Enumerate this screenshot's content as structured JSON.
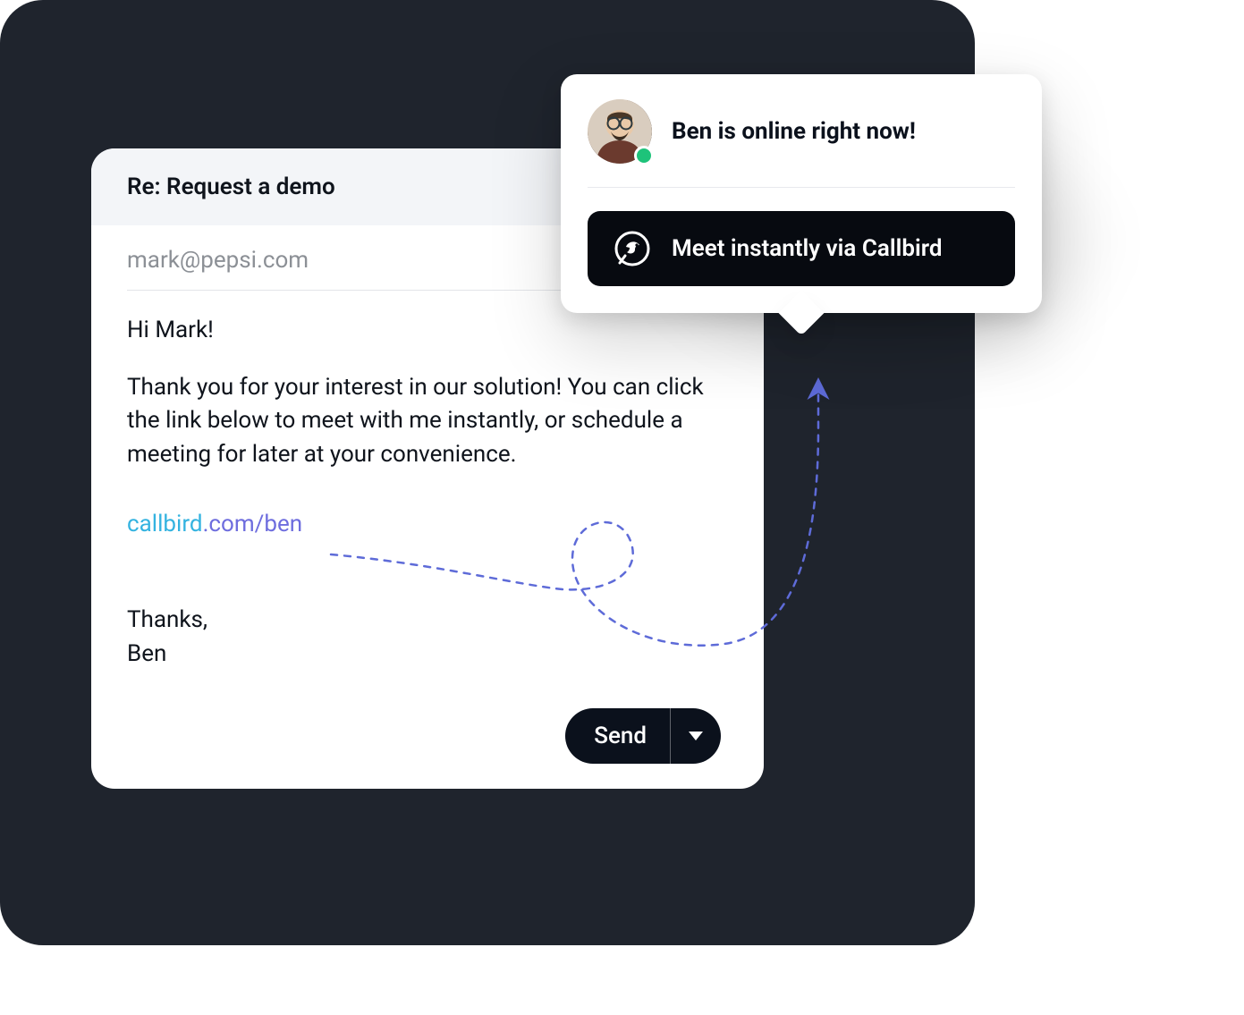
{
  "email": {
    "subject": "Re: Request a demo",
    "to": "mark@pepsi.com",
    "greeting": "Hi Mark!",
    "paragraph": "Thank you for your interest in our solution! You can click the link below to meet with me instantly, or schedule a meeting for later at your convenience.",
    "link_part1": "callbird",
    "link_part2": ".com/ben",
    "signoff_thanks": "Thanks,",
    "signoff_name": "Ben",
    "send_label": "Send"
  },
  "popup": {
    "status_text": "Ben is online right now!",
    "meet_label": "Meet instantly via Callbird"
  }
}
